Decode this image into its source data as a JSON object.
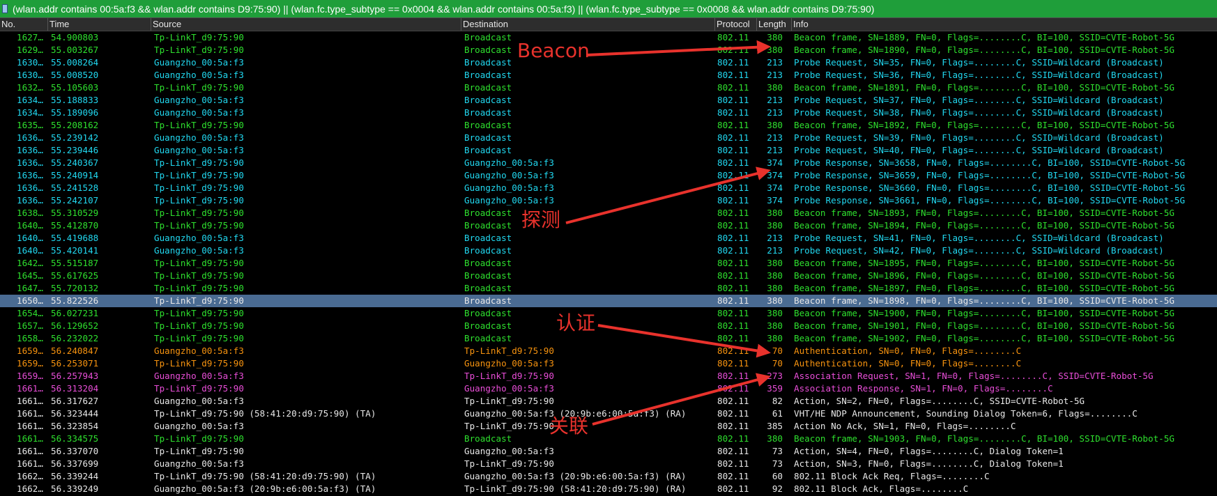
{
  "filter": {
    "value": "(wlan.addr contains 00:5a:f3 && wlan.addr contains D9:75:90) || (wlan.fc.type_subtype == 0x0004 && wlan.addr contains 00:5a:f3) || (wlan.fc.type_subtype == 0x0008 && wlan.addr contains D9:75:90)"
  },
  "columns": {
    "no": "No.",
    "time": "Time",
    "source": "Source",
    "destination": "Destination",
    "protocol": "Protocol",
    "length": "Length",
    "info": "Info"
  },
  "colors": {
    "beacon": "#2ee02e",
    "probe": "#21d8f0",
    "auth": "#f7930f",
    "assoc": "#e94ed8",
    "other": "#e8e8e8",
    "selected_bg": "#4a6b92",
    "annotation": "#e8322c"
  },
  "rows": [
    {
      "no": "1627…",
      "time": "54.900803",
      "source": "Tp-LinkT_d9:75:90",
      "destination": "Broadcast",
      "protocol": "802.11",
      "length": "380",
      "info": "Beacon frame, SN=1889, FN=0, Flags=........C, BI=100, SSID=CVTE-Robot-5G",
      "color": "beacon"
    },
    {
      "no": "1629…",
      "time": "55.003267",
      "source": "Tp-LinkT_d9:75:90",
      "destination": "Broadcast",
      "protocol": "802.11",
      "length": "380",
      "info": "Beacon frame, SN=1890, FN=0, Flags=........C, BI=100, SSID=CVTE-Robot-5G",
      "color": "beacon"
    },
    {
      "no": "1630…",
      "time": "55.008264",
      "source": "Guangzho_00:5a:f3",
      "destination": "Broadcast",
      "protocol": "802.11",
      "length": "213",
      "info": "Probe Request, SN=35, FN=0, Flags=........C, SSID=Wildcard (Broadcast)",
      "color": "probe"
    },
    {
      "no": "1630…",
      "time": "55.008520",
      "source": "Guangzho_00:5a:f3",
      "destination": "Broadcast",
      "protocol": "802.11",
      "length": "213",
      "info": "Probe Request, SN=36, FN=0, Flags=........C, SSID=Wildcard (Broadcast)",
      "color": "probe"
    },
    {
      "no": "1632…",
      "time": "55.105603",
      "source": "Tp-LinkT_d9:75:90",
      "destination": "Broadcast",
      "protocol": "802.11",
      "length": "380",
      "info": "Beacon frame, SN=1891, FN=0, Flags=........C, BI=100, SSID=CVTE-Robot-5G",
      "color": "beacon"
    },
    {
      "no": "1634…",
      "time": "55.188833",
      "source": "Guangzho_00:5a:f3",
      "destination": "Broadcast",
      "protocol": "802.11",
      "length": "213",
      "info": "Probe Request, SN=37, FN=0, Flags=........C, SSID=Wildcard (Broadcast)",
      "color": "probe"
    },
    {
      "no": "1634…",
      "time": "55.189096",
      "source": "Guangzho_00:5a:f3",
      "destination": "Broadcast",
      "protocol": "802.11",
      "length": "213",
      "info": "Probe Request, SN=38, FN=0, Flags=........C, SSID=Wildcard (Broadcast)",
      "color": "probe"
    },
    {
      "no": "1635…",
      "time": "55.208162",
      "source": "Tp-LinkT_d9:75:90",
      "destination": "Broadcast",
      "protocol": "802.11",
      "length": "380",
      "info": "Beacon frame, SN=1892, FN=0, Flags=........C, BI=100, SSID=CVTE-Robot-5G",
      "color": "beacon"
    },
    {
      "no": "1636…",
      "time": "55.239142",
      "source": "Guangzho_00:5a:f3",
      "destination": "Broadcast",
      "protocol": "802.11",
      "length": "213",
      "info": "Probe Request, SN=39, FN=0, Flags=........C, SSID=Wildcard (Broadcast)",
      "color": "probe"
    },
    {
      "no": "1636…",
      "time": "55.239446",
      "source": "Guangzho_00:5a:f3",
      "destination": "Broadcast",
      "protocol": "802.11",
      "length": "213",
      "info": "Probe Request, SN=40, FN=0, Flags=........C, SSID=Wildcard (Broadcast)",
      "color": "probe"
    },
    {
      "no": "1636…",
      "time": "55.240367",
      "source": "Tp-LinkT_d9:75:90",
      "destination": "Guangzho_00:5a:f3",
      "protocol": "802.11",
      "length": "374",
      "info": "Probe Response, SN=3658, FN=0, Flags=........C, BI=100, SSID=CVTE-Robot-5G",
      "color": "probe"
    },
    {
      "no": "1636…",
      "time": "55.240914",
      "source": "Tp-LinkT_d9:75:90",
      "destination": "Guangzho_00:5a:f3",
      "protocol": "802.11",
      "length": "374",
      "info": "Probe Response, SN=3659, FN=0, Flags=........C, BI=100, SSID=CVTE-Robot-5G",
      "color": "probe"
    },
    {
      "no": "1636…",
      "time": "55.241528",
      "source": "Tp-LinkT_d9:75:90",
      "destination": "Guangzho_00:5a:f3",
      "protocol": "802.11",
      "length": "374",
      "info": "Probe Response, SN=3660, FN=0, Flags=........C, BI=100, SSID=CVTE-Robot-5G",
      "color": "probe"
    },
    {
      "no": "1636…",
      "time": "55.242107",
      "source": "Tp-LinkT_d9:75:90",
      "destination": "Guangzho_00:5a:f3",
      "protocol": "802.11",
      "length": "374",
      "info": "Probe Response, SN=3661, FN=0, Flags=........C, BI=100, SSID=CVTE-Robot-5G",
      "color": "probe"
    },
    {
      "no": "1638…",
      "time": "55.310529",
      "source": "Tp-LinkT_d9:75:90",
      "destination": "Broadcast",
      "protocol": "802.11",
      "length": "380",
      "info": "Beacon frame, SN=1893, FN=0, Flags=........C, BI=100, SSID=CVTE-Robot-5G",
      "color": "beacon"
    },
    {
      "no": "1640…",
      "time": "55.412870",
      "source": "Tp-LinkT_d9:75:90",
      "destination": "Broadcast",
      "protocol": "802.11",
      "length": "380",
      "info": "Beacon frame, SN=1894, FN=0, Flags=........C, BI=100, SSID=CVTE-Robot-5G",
      "color": "beacon"
    },
    {
      "no": "1640…",
      "time": "55.419688",
      "source": "Guangzho_00:5a:f3",
      "destination": "Broadcast",
      "protocol": "802.11",
      "length": "213",
      "info": "Probe Request, SN=41, FN=0, Flags=........C, SSID=Wildcard (Broadcast)",
      "color": "probe"
    },
    {
      "no": "1640…",
      "time": "55.420141",
      "source": "Guangzho_00:5a:f3",
      "destination": "Broadcast",
      "protocol": "802.11",
      "length": "213",
      "info": "Probe Request, SN=42, FN=0, Flags=........C, SSID=Wildcard (Broadcast)",
      "color": "probe"
    },
    {
      "no": "1642…",
      "time": "55.515187",
      "source": "Tp-LinkT_d9:75:90",
      "destination": "Broadcast",
      "protocol": "802.11",
      "length": "380",
      "info": "Beacon frame, SN=1895, FN=0, Flags=........C, BI=100, SSID=CVTE-Robot-5G",
      "color": "beacon"
    },
    {
      "no": "1645…",
      "time": "55.617625",
      "source": "Tp-LinkT_d9:75:90",
      "destination": "Broadcast",
      "protocol": "802.11",
      "length": "380",
      "info": "Beacon frame, SN=1896, FN=0, Flags=........C, BI=100, SSID=CVTE-Robot-5G",
      "color": "beacon"
    },
    {
      "no": "1647…",
      "time": "55.720132",
      "source": "Tp-LinkT_d9:75:90",
      "destination": "Broadcast",
      "protocol": "802.11",
      "length": "380",
      "info": "Beacon frame, SN=1897, FN=0, Flags=........C, BI=100, SSID=CVTE-Robot-5G",
      "color": "beacon"
    },
    {
      "no": "1650…",
      "time": "55.822526",
      "source": "Tp-LinkT_d9:75:90",
      "destination": "Broadcast",
      "protocol": "802.11",
      "length": "380",
      "info": "Beacon frame, SN=1898, FN=0, Flags=........C, BI=100, SSID=CVTE-Robot-5G",
      "color": "other",
      "selected": true
    },
    {
      "no": "1654…",
      "time": "56.027231",
      "source": "Tp-LinkT_d9:75:90",
      "destination": "Broadcast",
      "protocol": "802.11",
      "length": "380",
      "info": "Beacon frame, SN=1900, FN=0, Flags=........C, BI=100, SSID=CVTE-Robot-5G",
      "color": "beacon"
    },
    {
      "no": "1657…",
      "time": "56.129652",
      "source": "Tp-LinkT_d9:75:90",
      "destination": "Broadcast",
      "protocol": "802.11",
      "length": "380",
      "info": "Beacon frame, SN=1901, FN=0, Flags=........C, BI=100, SSID=CVTE-Robot-5G",
      "color": "beacon"
    },
    {
      "no": "1658…",
      "time": "56.232022",
      "source": "Tp-LinkT_d9:75:90",
      "destination": "Broadcast",
      "protocol": "802.11",
      "length": "380",
      "info": "Beacon frame, SN=1902, FN=0, Flags=........C, BI=100, SSID=CVTE-Robot-5G",
      "color": "beacon"
    },
    {
      "no": "1659…",
      "time": "56.240847",
      "source": "Guangzho_00:5a:f3",
      "destination": "Tp-LinkT_d9:75:90",
      "protocol": "802.11",
      "length": "70",
      "info": "Authentication, SN=0, FN=0, Flags=........C",
      "color": "auth"
    },
    {
      "no": "1659…",
      "time": "56.253071",
      "source": "Tp-LinkT_d9:75:90",
      "destination": "Guangzho_00:5a:f3",
      "protocol": "802.11",
      "length": "70",
      "info": "Authentication, SN=0, FN=0, Flags=........C",
      "color": "auth"
    },
    {
      "no": "1659…",
      "time": "56.257943",
      "source": "Guangzho_00:5a:f3",
      "destination": "Tp-LinkT_d9:75:90",
      "protocol": "802.11",
      "length": "273",
      "info": "Association Request, SN=1, FN=0, Flags=........C, SSID=CVTE-Robot-5G",
      "color": "assoc"
    },
    {
      "no": "1661…",
      "time": "56.313204",
      "source": "Tp-LinkT_d9:75:90",
      "destination": "Guangzho_00:5a:f3",
      "protocol": "802.11",
      "length": "359",
      "info": "Association Response, SN=1, FN=0, Flags=........C",
      "color": "assoc"
    },
    {
      "no": "1661…",
      "time": "56.317627",
      "source": "Guangzho_00:5a:f3",
      "destination": "Tp-LinkT_d9:75:90",
      "protocol": "802.11",
      "length": "82",
      "info": "Action, SN=2, FN=0, Flags=........C, SSID=CVTE-Robot-5G",
      "color": "other"
    },
    {
      "no": "1661…",
      "time": "56.323444",
      "source": "Tp-LinkT_d9:75:90 (58:41:20:d9:75:90) (TA)",
      "destination": "Guangzho_00:5a:f3 (20:9b:e6:00:5a:f3) (RA)",
      "protocol": "802.11",
      "length": "61",
      "info": "VHT/HE NDP Announcement, Sounding Dialog Token=6, Flags=........C",
      "color": "other"
    },
    {
      "no": "1661…",
      "time": "56.323854",
      "source": "Guangzho_00:5a:f3",
      "destination": "Tp-LinkT_d9:75:90",
      "protocol": "802.11",
      "length": "385",
      "info": "Action No Ack, SN=1, FN=0, Flags=........C",
      "color": "other"
    },
    {
      "no": "1661…",
      "time": "56.334575",
      "source": "Tp-LinkT_d9:75:90",
      "destination": "Broadcast",
      "protocol": "802.11",
      "length": "380",
      "info": "Beacon frame, SN=1903, FN=0, Flags=........C, BI=100, SSID=CVTE-Robot-5G",
      "color": "beacon"
    },
    {
      "no": "1661…",
      "time": "56.337070",
      "source": "Tp-LinkT_d9:75:90",
      "destination": "Guangzho_00:5a:f3",
      "protocol": "802.11",
      "length": "73",
      "info": "Action, SN=4, FN=0, Flags=........C, Dialog Token=1",
      "color": "other"
    },
    {
      "no": "1661…",
      "time": "56.337699",
      "source": "Guangzho_00:5a:f3",
      "destination": "Tp-LinkT_d9:75:90",
      "protocol": "802.11",
      "length": "73",
      "info": "Action, SN=3, FN=0, Flags=........C, Dialog Token=1",
      "color": "other"
    },
    {
      "no": "1662…",
      "time": "56.339244",
      "source": "Tp-LinkT_d9:75:90 (58:41:20:d9:75:90) (TA)",
      "destination": "Guangzho_00:5a:f3 (20:9b:e6:00:5a:f3) (RA)",
      "protocol": "802.11",
      "length": "60",
      "info": "802.11 Block Ack Req, Flags=........C",
      "color": "other"
    },
    {
      "no": "1662…",
      "time": "56.339249",
      "source": "Guangzho_00:5a:f3 (20:9b:e6:00:5a:f3) (TA)",
      "destination": "Tp-LinkT_d9:75:90 (58:41:20:d9:75:90) (RA)",
      "protocol": "802.11",
      "length": "92",
      "info": "802.11 Block Ack, Flags=........C",
      "color": "other"
    }
  ],
  "annotations": {
    "beacon": "Beacon",
    "probe": "探测",
    "auth": "认证",
    "assoc": "关联"
  }
}
